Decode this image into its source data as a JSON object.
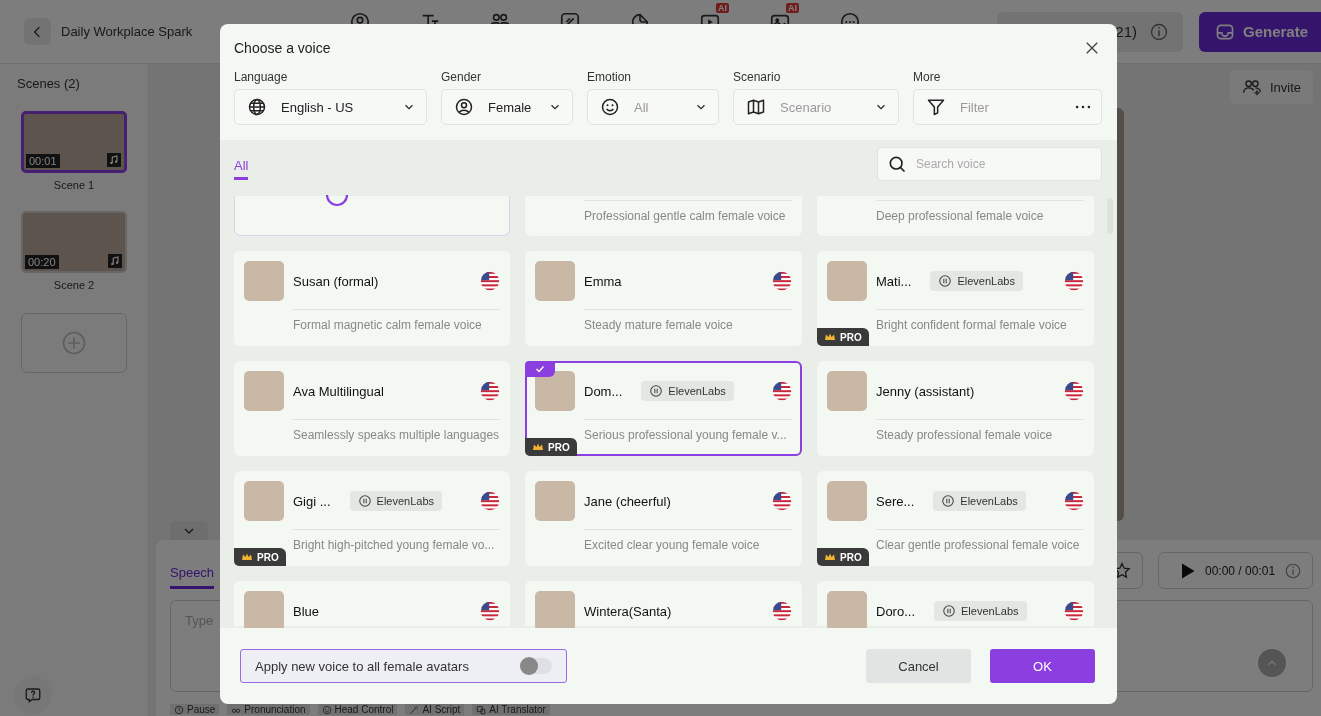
{
  "app": {
    "title": "Daily Workplace Spark",
    "ai_badges": [
      "AI",
      "AI"
    ],
    "credits": "21)",
    "generate": "Generate",
    "invite": "Invite",
    "scenes_title": "Scenes (2)",
    "scenes": [
      {
        "label": "Scene 1",
        "duration": "00:01",
        "selected": true
      },
      {
        "label": "Scene 2",
        "duration": "00:20",
        "selected": false
      }
    ],
    "speech_tab": "Speech",
    "script_placeholder": "Type",
    "playback_time": "00:00 / 00:01",
    "tools": [
      "Pause",
      "Pronunciation",
      "Head Control",
      "AI Script",
      "AI Translator"
    ]
  },
  "dialog": {
    "title": "Choose a voice",
    "filters": [
      {
        "label": "Language",
        "value": "English - US",
        "kind": "dropdown"
      },
      {
        "label": "Gender",
        "value": "Female",
        "kind": "dropdown"
      },
      {
        "label": "Emotion",
        "placeholder": "All",
        "kind": "dropdown"
      },
      {
        "label": "Scenario",
        "placeholder": "Scenario",
        "kind": "dropdown"
      },
      {
        "label": "More",
        "placeholder": "Filter",
        "kind": "menu"
      }
    ],
    "tabs": [
      {
        "label": "All",
        "selected": true
      }
    ],
    "search": {
      "placeholder": "Search voice"
    },
    "voices": [
      {
        "kind": "cut-top",
        "selected": false
      },
      {
        "kind": "cut-top",
        "description": "Professional gentle calm female voice",
        "selected": false
      },
      {
        "kind": "cut-top",
        "description": "Deep professional female voice",
        "selected": false
      },
      {
        "kind": "full",
        "name": "Susan (formal)",
        "description": "Formal magnetic calm female voice",
        "selected": false
      },
      {
        "kind": "full",
        "name": "Emma",
        "description": "Steady mature female voice",
        "selected": false
      },
      {
        "kind": "full",
        "name": "Mati...",
        "badge": "ElevenLabs",
        "description": "Bright confident formal female voice",
        "selected": false,
        "tier": "PRO"
      },
      {
        "kind": "full",
        "name": "Ava Multilingual",
        "description": "Seamlessly speaks multiple languages",
        "selected": false
      },
      {
        "kind": "full",
        "name": "Dom...",
        "badge": "ElevenLabs",
        "description": "Serious professional young female v...",
        "selected": true,
        "tier": "PRO"
      },
      {
        "kind": "full",
        "name": "Jenny (assistant)",
        "description": "Steady professional female voice",
        "selected": false
      },
      {
        "kind": "full",
        "name": "Gigi ...",
        "badge": "ElevenLabs",
        "description": "Bright high-pitched young female vo...",
        "selected": false,
        "tier": "PRO"
      },
      {
        "kind": "full",
        "name": "Jane (cheerful)",
        "description": "Excited clear young female voice",
        "selected": false
      },
      {
        "kind": "full",
        "name": "Sere...",
        "badge": "ElevenLabs",
        "description": "Clear gentle professional female voice",
        "selected": false,
        "tier": "PRO"
      },
      {
        "kind": "cut-bottom",
        "name": "Blue",
        "selected": false
      },
      {
        "kind": "cut-bottom",
        "name": "Wintera(Santa)",
        "selected": false
      },
      {
        "kind": "cut-bottom",
        "name": "Doro...",
        "badge": "ElevenLabs",
        "selected": false
      }
    ],
    "apply_toggle": {
      "label": "Apply new voice to all female avatars",
      "on": false
    },
    "buttons": [
      {
        "label": "Cancel",
        "kind": "secondary"
      },
      {
        "label": "OK",
        "kind": "primary"
      }
    ]
  }
}
